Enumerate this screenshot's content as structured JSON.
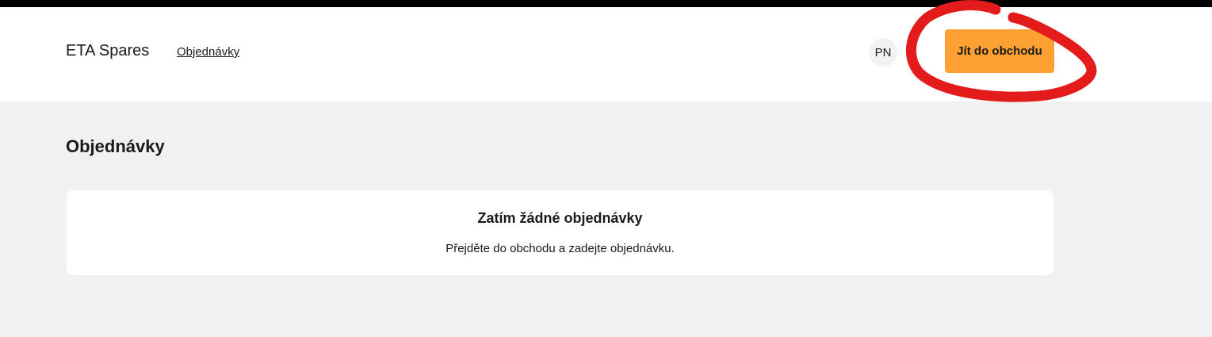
{
  "header": {
    "brand": "ETA Spares",
    "nav_orders_label": "Objednávky",
    "avatar_initials": "PN",
    "shop_button_label": "Jít do obchodu",
    "accent_color": "#ffa033"
  },
  "annotation": {
    "color": "#e31b1b"
  },
  "main": {
    "title": "Objednávky",
    "empty_state": {
      "title": "Zatím žádné objednávky",
      "text": "Přejděte do obchodu a zadejte objednávku."
    }
  }
}
